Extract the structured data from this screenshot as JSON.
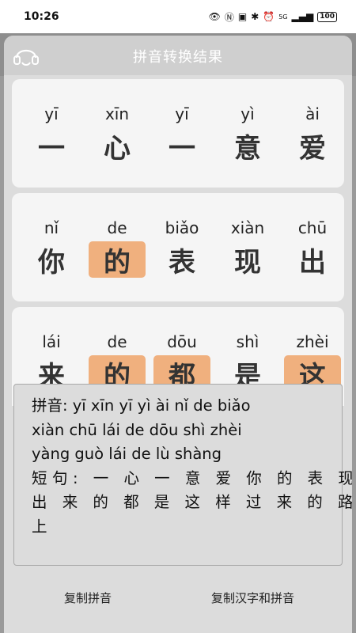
{
  "status": {
    "time": "10:26",
    "signal": "5G",
    "battery": "100"
  },
  "header": {
    "title": "拼音转换结果"
  },
  "cards": [
    {
      "chars": [
        {
          "pinyin": "yī",
          "hanzi": "一",
          "highlight": false
        },
        {
          "pinyin": "xīn",
          "hanzi": "心",
          "highlight": false
        },
        {
          "pinyin": "yī",
          "hanzi": "一",
          "highlight": false
        },
        {
          "pinyin": "yì",
          "hanzi": "意",
          "highlight": false
        },
        {
          "pinyin": "ài",
          "hanzi": "爱",
          "highlight": false
        }
      ]
    },
    {
      "chars": [
        {
          "pinyin": "nǐ",
          "hanzi": "你",
          "highlight": false
        },
        {
          "pinyin": "de",
          "hanzi": "的",
          "highlight": true
        },
        {
          "pinyin": "biǎo",
          "hanzi": "表",
          "highlight": false
        },
        {
          "pinyin": "xiàn",
          "hanzi": "现",
          "highlight": false
        },
        {
          "pinyin": "chū",
          "hanzi": "出",
          "highlight": false
        }
      ]
    },
    {
      "chars": [
        {
          "pinyin": "lái",
          "hanzi": "来",
          "highlight": false
        },
        {
          "pinyin": "de",
          "hanzi": "的",
          "highlight": true
        },
        {
          "pinyin": "dōu",
          "hanzi": "都",
          "highlight": true
        },
        {
          "pinyin": "shì",
          "hanzi": "是",
          "highlight": false
        },
        {
          "pinyin": "zhèi",
          "hanzi": "这",
          "highlight": true
        }
      ]
    }
  ],
  "result": {
    "lines": [
      "拼音: yī xīn yī yì ài nǐ de biǎo",
      "xiàn chū lái de dōu shì zhèi",
      "yàng guò lái de lù shàng",
      "短句: 一 心 一 意 爱 你 的 表 现",
      "出 来 的 都 是 这 样 过 来 的 路",
      "上"
    ]
  },
  "buttons": {
    "copy_pinyin": "复制拼音",
    "copy_both": "复制汉字和拼音"
  },
  "colors": {
    "highlight": "#f0b07e",
    "sheet": "#dcdcdc",
    "card": "#f5f5f5"
  }
}
